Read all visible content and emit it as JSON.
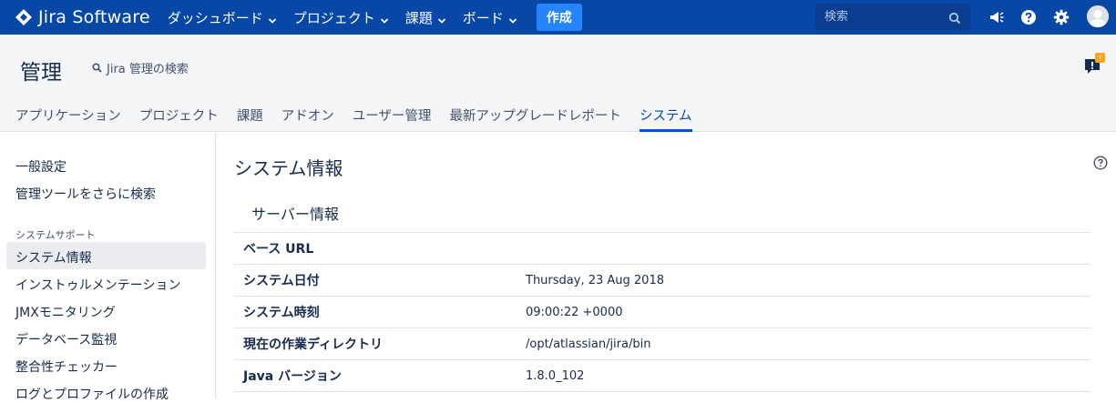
{
  "topbar": {
    "logo_text": "Jira Software",
    "nav": [
      {
        "label": "ダッシュボード"
      },
      {
        "label": "プロジェクト"
      },
      {
        "label": "課題"
      },
      {
        "label": "ボード"
      }
    ],
    "create_label": "作成",
    "search_placeholder": "検索",
    "icons": [
      "announcement-icon",
      "help-icon",
      "settings-icon",
      "avatar"
    ],
    "brand_color": "#0747A6"
  },
  "admin": {
    "title": "管理",
    "search_label": "Jira 管理の検索",
    "feedback_badge": "!",
    "tabs": [
      {
        "label": "アプリケーション"
      },
      {
        "label": "プロジェクト"
      },
      {
        "label": "課題"
      },
      {
        "label": "アドオン"
      },
      {
        "label": "ユーザー管理"
      },
      {
        "label": "最新アップグレードレポート"
      },
      {
        "label": "システム",
        "active": true
      }
    ]
  },
  "sidebar": {
    "links_top": [
      {
        "label": "一般設定"
      },
      {
        "label": "管理ツールをさらに検索"
      }
    ],
    "section_heading": "システムサポート",
    "links_support": [
      {
        "label": "システム情報",
        "selected": true
      },
      {
        "label": "インストゥルメンテーション"
      },
      {
        "label": "JMXモニタリング"
      },
      {
        "label": "データベース監視"
      },
      {
        "label": "整合性チェッカー"
      },
      {
        "label": "ログとプロファイルの作成"
      }
    ]
  },
  "main": {
    "title": "システム情報",
    "section_title": "サーバー情報",
    "rows": [
      {
        "key": "ベース URL",
        "value": ""
      },
      {
        "key": "システム日付",
        "value": "Thursday, 23 Aug 2018"
      },
      {
        "key": "システム時刻",
        "value": "09:00:22 +0000"
      },
      {
        "key": "現在の作業ディレクトリ",
        "value": "/opt/atlassian/jira/bin"
      },
      {
        "key": "Java バージョン",
        "value": "1.8.0_102"
      }
    ]
  }
}
